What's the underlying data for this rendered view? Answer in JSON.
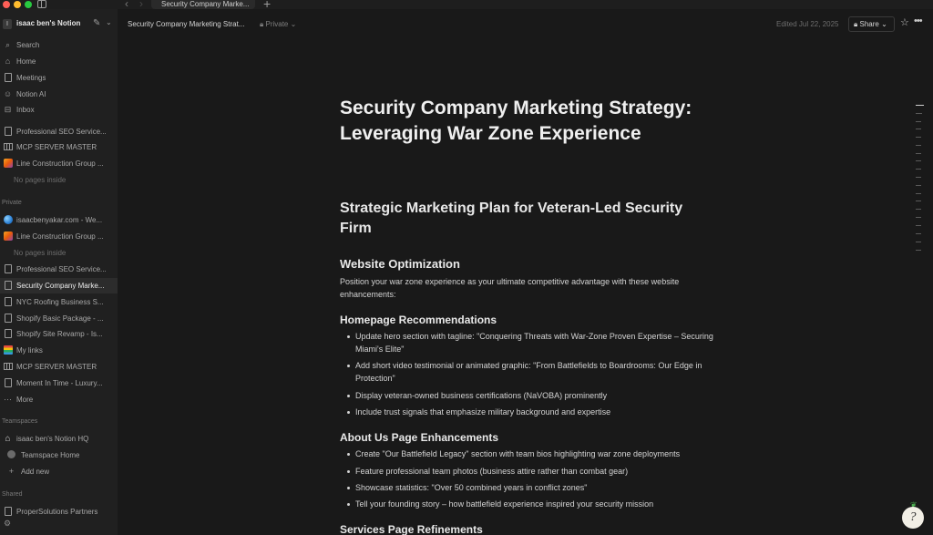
{
  "window": {
    "tab_title": "Security Company Marke..."
  },
  "sidebar": {
    "workspace_name": "isaac ben's Notion",
    "workspace_initial": "I",
    "nav": [
      {
        "label": "Search",
        "icon": "search-icon"
      },
      {
        "label": "Home",
        "icon": "home-icon"
      },
      {
        "label": "Meetings",
        "icon": "meetings-icon"
      },
      {
        "label": "Notion AI",
        "icon": "notion-ai-icon"
      },
      {
        "label": "Inbox",
        "icon": "inbox-icon"
      }
    ],
    "favorites": [
      {
        "label": "Professional SEO Service...",
        "icon": "page-icon"
      },
      {
        "label": "MCP SERVER MASTER",
        "icon": "table-icon"
      },
      {
        "label": "Line Construction Group ...",
        "icon": "image-emoji-icon"
      },
      {
        "label": "No pages inside"
      }
    ],
    "private_label": "Private",
    "private_items": [
      {
        "label": "isaacbenyakar.com - We...",
        "icon": "globe-icon"
      },
      {
        "label": "Line Construction Group ...",
        "icon": "image-emoji-icon"
      },
      {
        "label": "No pages inside"
      },
      {
        "label": "Professional SEO Service...",
        "icon": "page-icon"
      },
      {
        "label": "Security Company Marke...",
        "icon": "page-icon",
        "active": true
      },
      {
        "label": "NYC Roofing Business S...",
        "icon": "page-icon"
      },
      {
        "label": "Shopify Basic Package - ...",
        "icon": "page-icon"
      },
      {
        "label": "Shopify Site Revamp - Is...",
        "icon": "page-icon"
      },
      {
        "label": "My links",
        "icon": "books-icon"
      },
      {
        "label": "MCP SERVER MASTER",
        "icon": "table-icon"
      },
      {
        "label": "Moment In Time - Luxury...",
        "icon": "page-icon"
      },
      {
        "label": "More",
        "icon": "more-icon"
      }
    ],
    "teamspaces_label": "Teamspaces",
    "teamspace_items": [
      {
        "label": "isaac ben's Notion HQ",
        "icon": "house-icon"
      },
      {
        "label": "Teamspace Home",
        "icon": "teamspace-icon"
      },
      {
        "label": "Add new",
        "icon": "plus-icon"
      }
    ],
    "shared_label": "Shared",
    "shared_items": [
      {
        "label": "ProperSolutions Partners",
        "icon": "page-icon"
      }
    ]
  },
  "topbar": {
    "breadcrumb": "Security Company Marketing Strat...",
    "privacy": "Private",
    "edited": "Edited Jul 22, 2025",
    "share_label": "Share"
  },
  "doc": {
    "title": "Security Company Marketing Strategy: Leveraging War Zone Experience",
    "h2": "Strategic Marketing Plan for Veteran-Led Security Firm",
    "section1_heading": "Website Optimization",
    "section1_para": "Position your war zone experience as your ultimate competitive advantage with these website enhancements:",
    "homepage_heading": "Homepage Recommendations",
    "homepage_bullets": [
      "Update hero section with tagline: \"Conquering Threats with War-Zone Proven Expertise – Securing Miami's Elite\"",
      "Add short video testimonial or animated graphic: \"From Battlefields to Boardrooms: Our Edge in Protection\"",
      "Display veteran-owned business certifications (NaVOBA) prominently",
      "Include trust signals that emphasize military background and expertise"
    ],
    "about_heading": "About Us Page Enhancements",
    "about_bullets": [
      "Create \"Our Battlefield Legacy\" section with team bios highlighting war zone deployments",
      "Feature professional team photos (business attire rather than combat gear)",
      "Showcase statistics: \"Over 50 combined years in conflict zones\"",
      "Tell your founding story – how battlefield experience inspired your security mission"
    ],
    "services_heading": "Services Page Refinements"
  },
  "help_glyph": "?"
}
